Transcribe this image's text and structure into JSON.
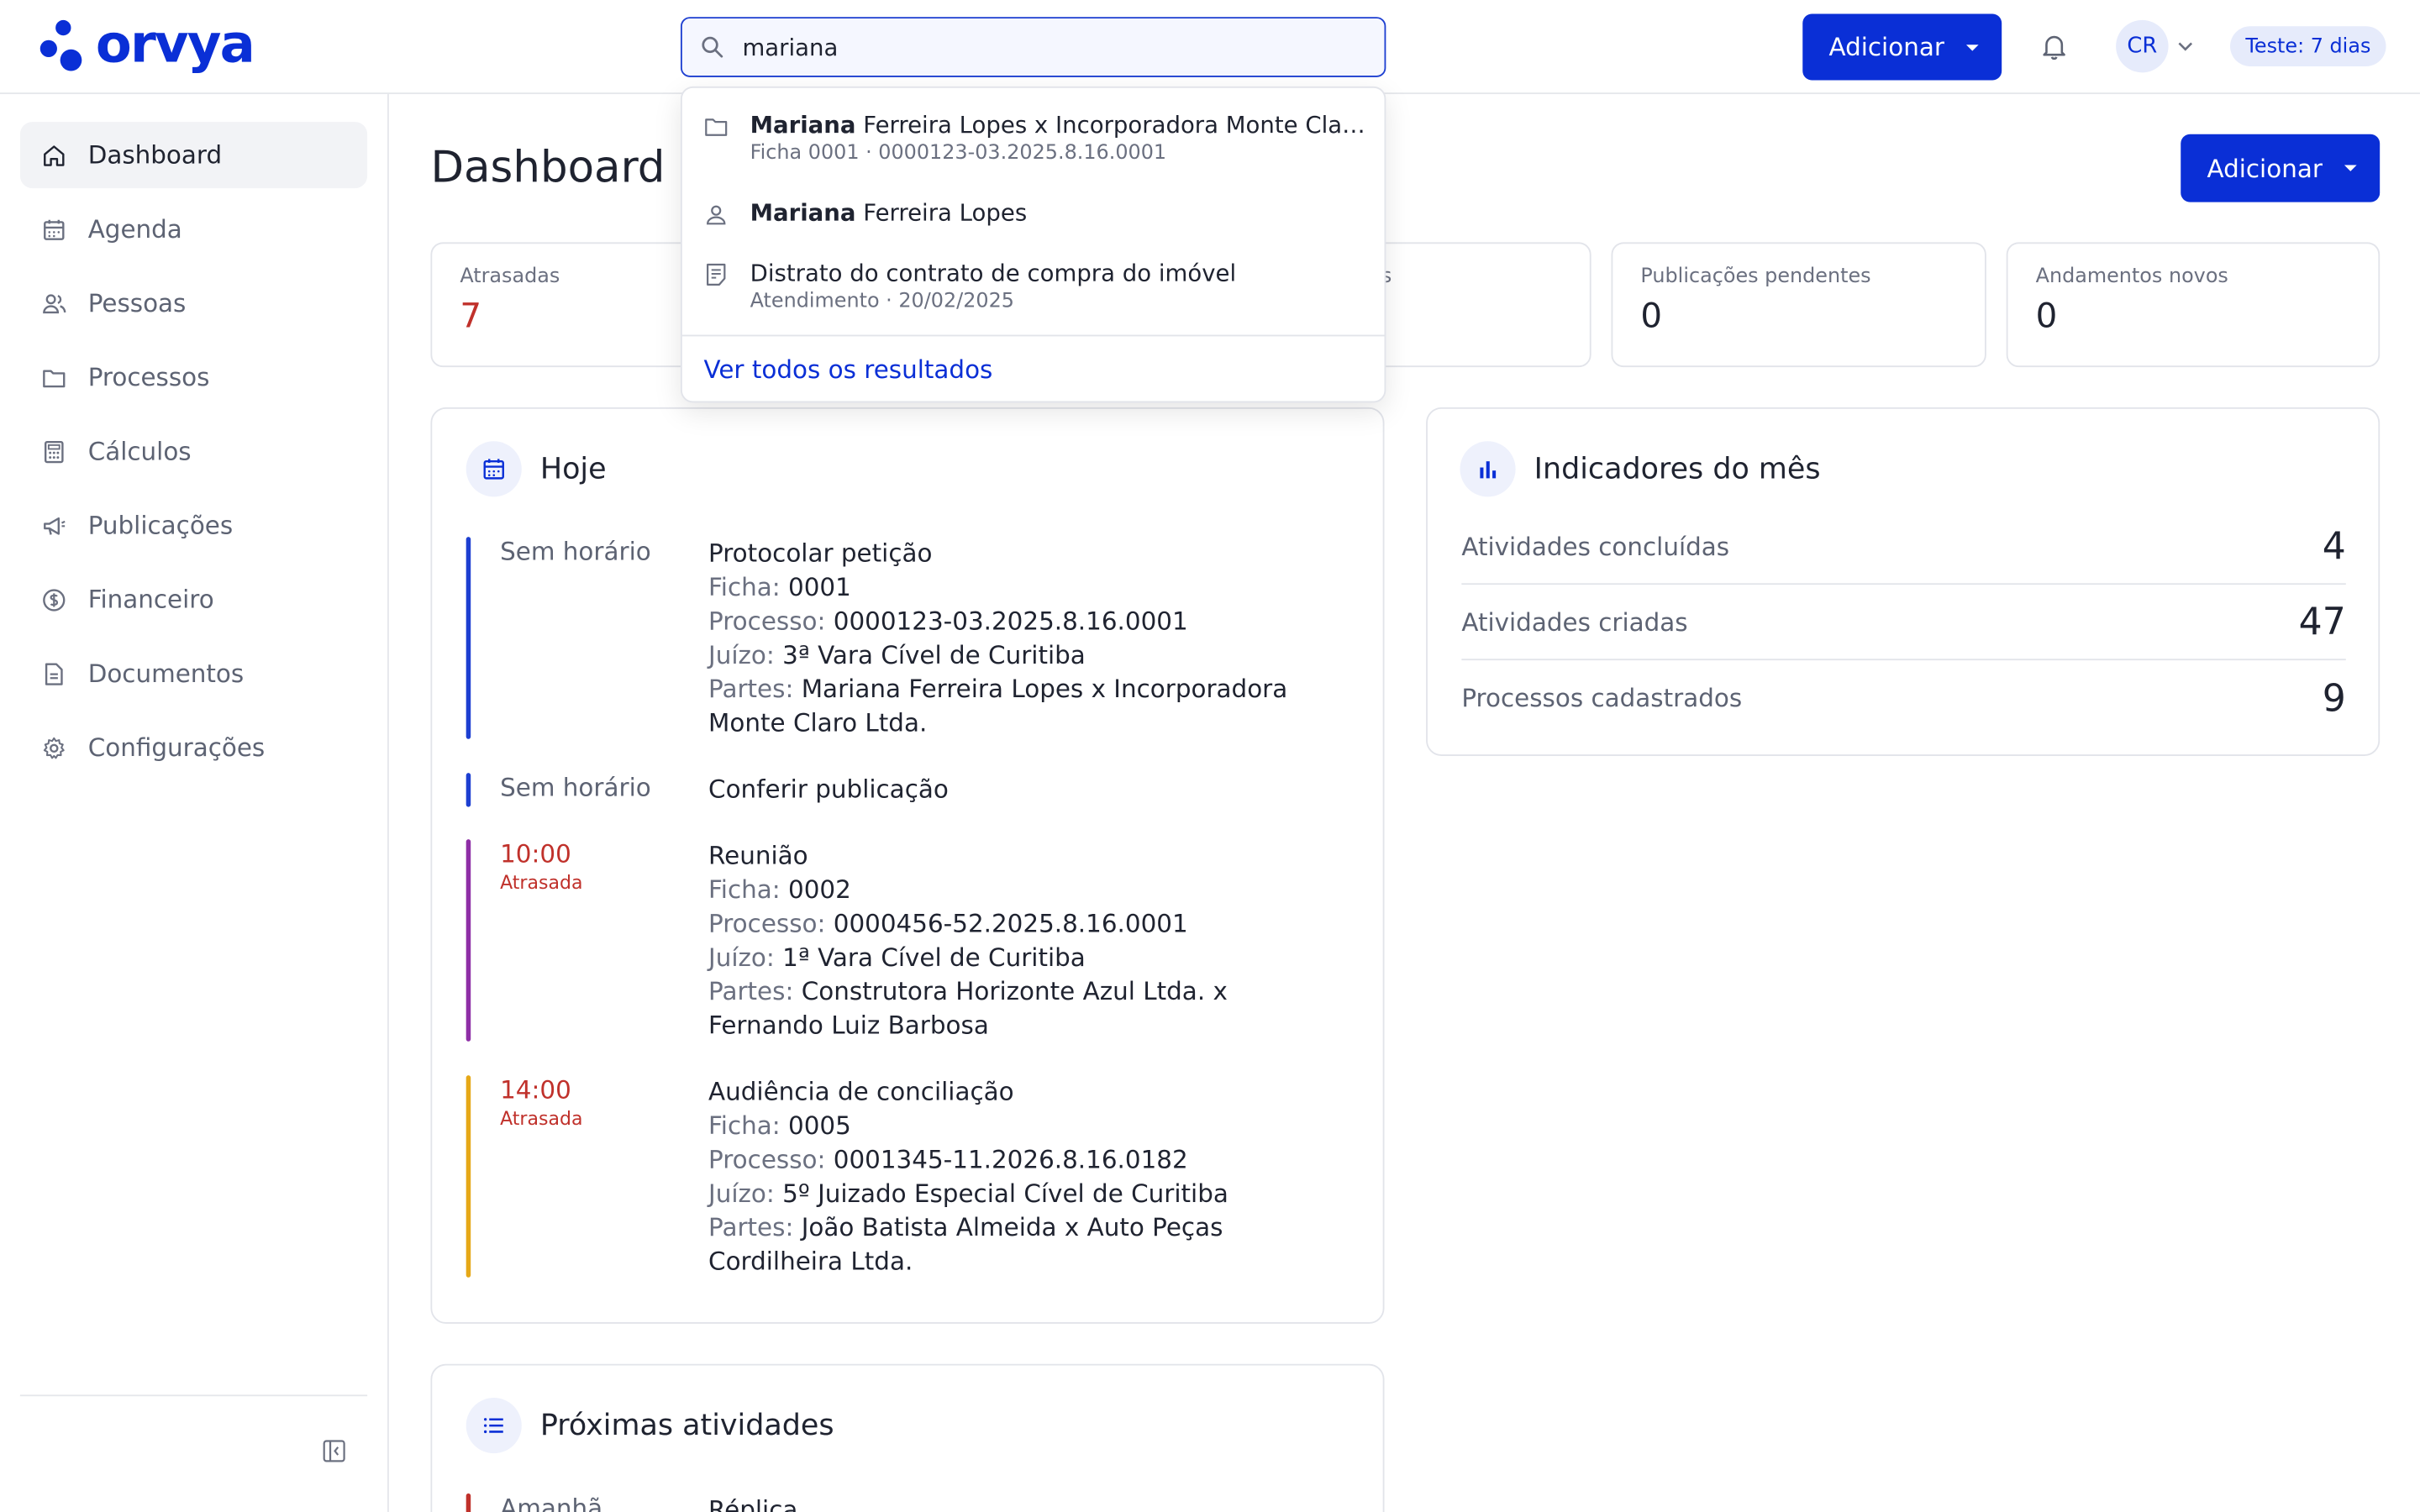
{
  "header": {
    "logo_text": "orvya",
    "search_value": "mariana",
    "add_label": "Adicionar",
    "avatar_initials": "CR",
    "trial_label": "Teste: 7 dias"
  },
  "sidebar": {
    "items": [
      {
        "label": "Dashboard",
        "icon": "home-icon",
        "active": true
      },
      {
        "label": "Agenda",
        "icon": "calendar-icon"
      },
      {
        "label": "Pessoas",
        "icon": "people-icon"
      },
      {
        "label": "Processos",
        "icon": "folder-icon"
      },
      {
        "label": "Cálculos",
        "icon": "calculator-icon"
      },
      {
        "label": "Publicações",
        "icon": "megaphone-icon"
      },
      {
        "label": "Financeiro",
        "icon": "dollar-icon"
      },
      {
        "label": "Documentos",
        "icon": "document-icon"
      },
      {
        "label": "Configurações",
        "icon": "gear-icon"
      }
    ]
  },
  "main": {
    "title": "Dashboard",
    "add_label": "Adicionar",
    "stats": [
      {
        "label": "Atrasadas",
        "value": "7"
      },
      {
        "label": "s",
        "value": ""
      },
      {
        "label": "Publicações pendentes",
        "value": "0"
      },
      {
        "label": "Andamentos novos",
        "value": "0"
      }
    ],
    "today": {
      "title": "Hoje",
      "activities": [
        {
          "time": "Sem horário",
          "status": "",
          "color": "#1d3fd1",
          "title": "Protocolar petição",
          "ficha_label": "Ficha:",
          "ficha": "0001",
          "processo_label": "Processo:",
          "processo": "0000123-03.2025.8.16.0001",
          "juizo_label": "Juízo:",
          "juizo": "3ª Vara Cível de Curitiba",
          "partes_label": "Partes:",
          "partes": "Mariana Ferreira Lopes x Incorporadora Monte Claro Ltda."
        },
        {
          "time": "Sem horário",
          "status": "",
          "color": "#1d3fd1",
          "title": "Conferir publicação"
        },
        {
          "time": "10:00",
          "status": "Atrasada",
          "color": "#8e2ea6",
          "title": "Reunião",
          "ficha_label": "Ficha:",
          "ficha": "0002",
          "processo_label": "Processo:",
          "processo": "0000456-52.2025.8.16.0001",
          "juizo_label": "Juízo:",
          "juizo": "1ª Vara Cível de Curitiba",
          "partes_label": "Partes:",
          "partes": "Construtora Horizonte Azul Ltda. x Fernando Luiz Barbosa"
        },
        {
          "time": "14:00",
          "status": "Atrasada",
          "color": "#e6a817",
          "title": "Audiência de conciliação",
          "ficha_label": "Ficha:",
          "ficha": "0005",
          "processo_label": "Processo:",
          "processo": "0001345-11.2026.8.16.0182",
          "juizo_label": "Juízo:",
          "juizo": "5º Juizado Especial Cível de Curitiba",
          "partes_label": "Partes:",
          "partes": "João Batista Almeida x Auto Peças Cordilheira Ltda."
        }
      ]
    },
    "upcoming": {
      "title": "Próximas atividades",
      "first_time": "Amanhã",
      "first_title": "Réplica"
    },
    "indicators": {
      "title": "Indicadores do mês",
      "rows": [
        {
          "label": "Atividades concluídas",
          "value": "4"
        },
        {
          "label": "Atividades criadas",
          "value": "47"
        },
        {
          "label": "Processos cadastrados",
          "value": "9"
        }
      ]
    }
  },
  "search_results": {
    "items": [
      {
        "match": "Mariana",
        "rest": " Ferreira Lopes x Incorporadora Monte Claro Lt...",
        "sub": "Ficha 0001 · 0000123-03.2025.8.16.0001",
        "icon": "folder-icon"
      },
      {
        "match": "Mariana",
        "rest": " Ferreira Lopes",
        "sub": "",
        "icon": "person-icon"
      },
      {
        "match": "",
        "rest": "Distrato do contrato de compra do imóvel",
        "sub": "Atendimento · 20/02/2025",
        "icon": "note-icon"
      }
    ],
    "see_all": "Ver todos os resultados"
  },
  "colors": {
    "accent": "#0a2fd6",
    "late": "#c0312b"
  }
}
